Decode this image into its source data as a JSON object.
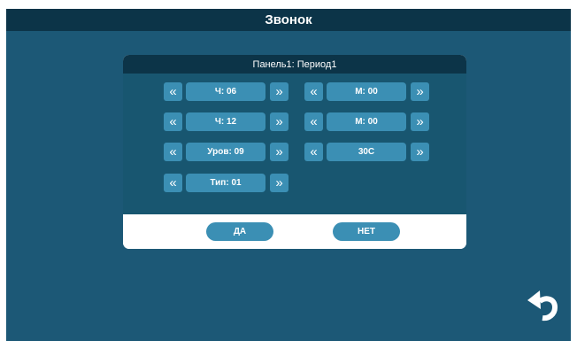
{
  "window": {
    "title": "Звонок"
  },
  "dialog": {
    "title": "Панель1: Период1",
    "rows": [
      {
        "left": "Ч: 06",
        "right": "М: 00"
      },
      {
        "left": "Ч: 12",
        "right": "М: 00"
      },
      {
        "left": "Уров: 09",
        "right": "30С"
      },
      {
        "left": "Тип: 01"
      }
    ],
    "prev_glyph": "«",
    "next_glyph": "»",
    "ok_label": "ДА",
    "cancel_label": "НЕТ"
  },
  "icons": {
    "prev": "chevron-double-left-icon",
    "next": "chevron-double-right-icon",
    "back": "back-arrow-icon"
  },
  "colors": {
    "background": "#1c5876",
    "header": "#0c3448",
    "button": "#3b8fb4",
    "footer": "#ffffff"
  }
}
